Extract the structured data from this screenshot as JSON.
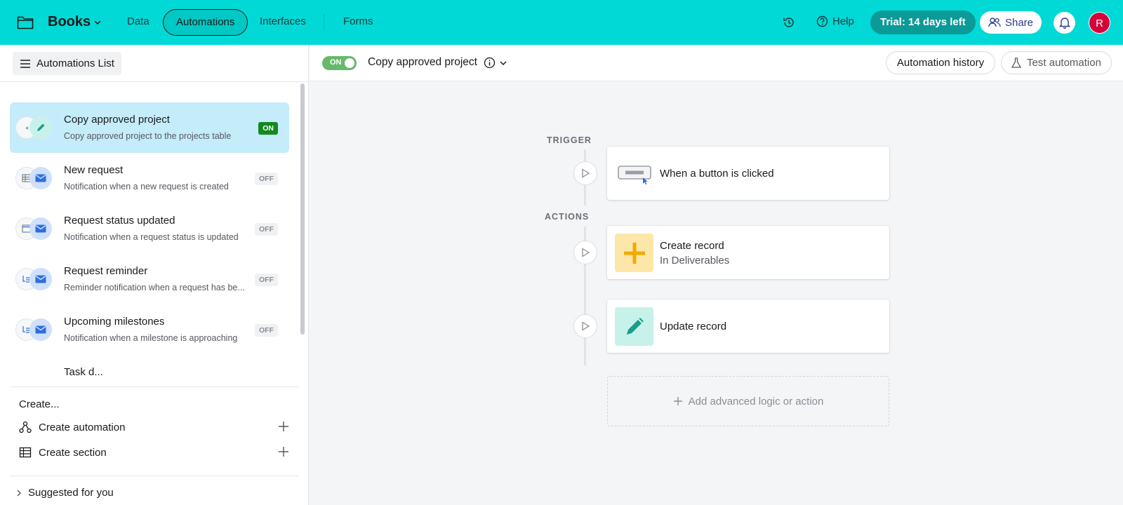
{
  "topbar": {
    "base_name": "Books",
    "tabs": [
      {
        "label": "Data",
        "active": false
      },
      {
        "label": "Automations",
        "active": true
      },
      {
        "label": "Interfaces",
        "active": false
      },
      {
        "label": "Forms",
        "active": false
      }
    ],
    "help_label": "Help",
    "trial_label": "Trial: 14 days left",
    "share_label": "Share",
    "avatar_initial": "R",
    "colors": {
      "bar": "#00d9d5",
      "trial": "#0b9a98",
      "avatar": "#d6003a"
    }
  },
  "sidebar": {
    "list_button_label": "Automations List",
    "automations": [
      {
        "name": "Copy approved project",
        "description": "Copy approved project to the projects table",
        "status": "ON",
        "selected": true,
        "icon": "pencil-icon"
      },
      {
        "name": "New request",
        "description": "Notification when a new request is created",
        "status": "OFF",
        "selected": false,
        "icon": "email-icon"
      },
      {
        "name": "Request status updated",
        "description": "Notification when a request status is updated",
        "status": "OFF",
        "selected": false,
        "icon": "email-icon"
      },
      {
        "name": "Request reminder",
        "description": "Reminder notification when a request has be...",
        "status": "OFF",
        "selected": false,
        "icon": "email-icon"
      },
      {
        "name": "Upcoming milestones",
        "description": "Notification when a milestone is approaching",
        "status": "OFF",
        "selected": false,
        "icon": "email-icon"
      },
      {
        "name": "Task d...",
        "description": "",
        "status": "",
        "selected": false,
        "icon": ""
      }
    ],
    "create_label": "Create...",
    "create_automation_label": "Create automation",
    "create_section_label": "Create section",
    "suggested_label": "Suggested for you"
  },
  "main": {
    "toggle_label": "ON",
    "automation_title": "Copy approved project",
    "history_label": "Automation history",
    "test_label": "Test automation",
    "trigger_label": "TRIGGER",
    "actions_label": "ACTIONS",
    "trigger": {
      "title": "When a button is clicked",
      "icon": "button-click-icon"
    },
    "actions": [
      {
        "title": "Create record",
        "subtitle": "In Deliverables",
        "icon": "plus-icon",
        "icon_bg": "#fde7a8",
        "icon_color": "#f5a800"
      },
      {
        "title": "Update record",
        "subtitle": "",
        "icon": "pencil-icon",
        "icon_bg": "#c6f2ea",
        "icon_color": "#1a9e8a"
      }
    ],
    "add_label": "Add advanced logic or action"
  }
}
